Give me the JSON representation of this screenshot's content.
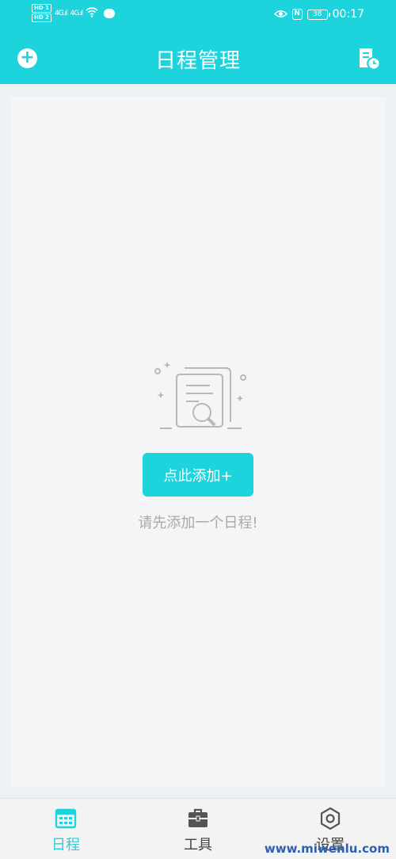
{
  "status_bar": {
    "hd1": "HD 1",
    "hd2": "HD 2",
    "network1": "4G.ıl",
    "network2": "4G.ıl",
    "nfc": "N",
    "battery": "38",
    "time": "00:17"
  },
  "header": {
    "title": "日程管理",
    "add_icon": "plus-circle-icon",
    "right_icon": "document-clock-icon"
  },
  "empty_state": {
    "illustration_icon": "document-search-icon",
    "button_label": "点此添加+",
    "hint": "请先添加一个日程!"
  },
  "tabs": [
    {
      "label": "日程",
      "icon": "calendar-icon",
      "active": true
    },
    {
      "label": "工具",
      "icon": "toolbox-icon",
      "active": false
    },
    {
      "label": "设置",
      "icon": "settings-hexagon-icon",
      "active": false
    }
  ],
  "watermark": "www.miwenlu.com",
  "colors": {
    "accent": "#1dd3dc",
    "background": "#f4f5f7",
    "hint_text": "#a9a9a9"
  }
}
